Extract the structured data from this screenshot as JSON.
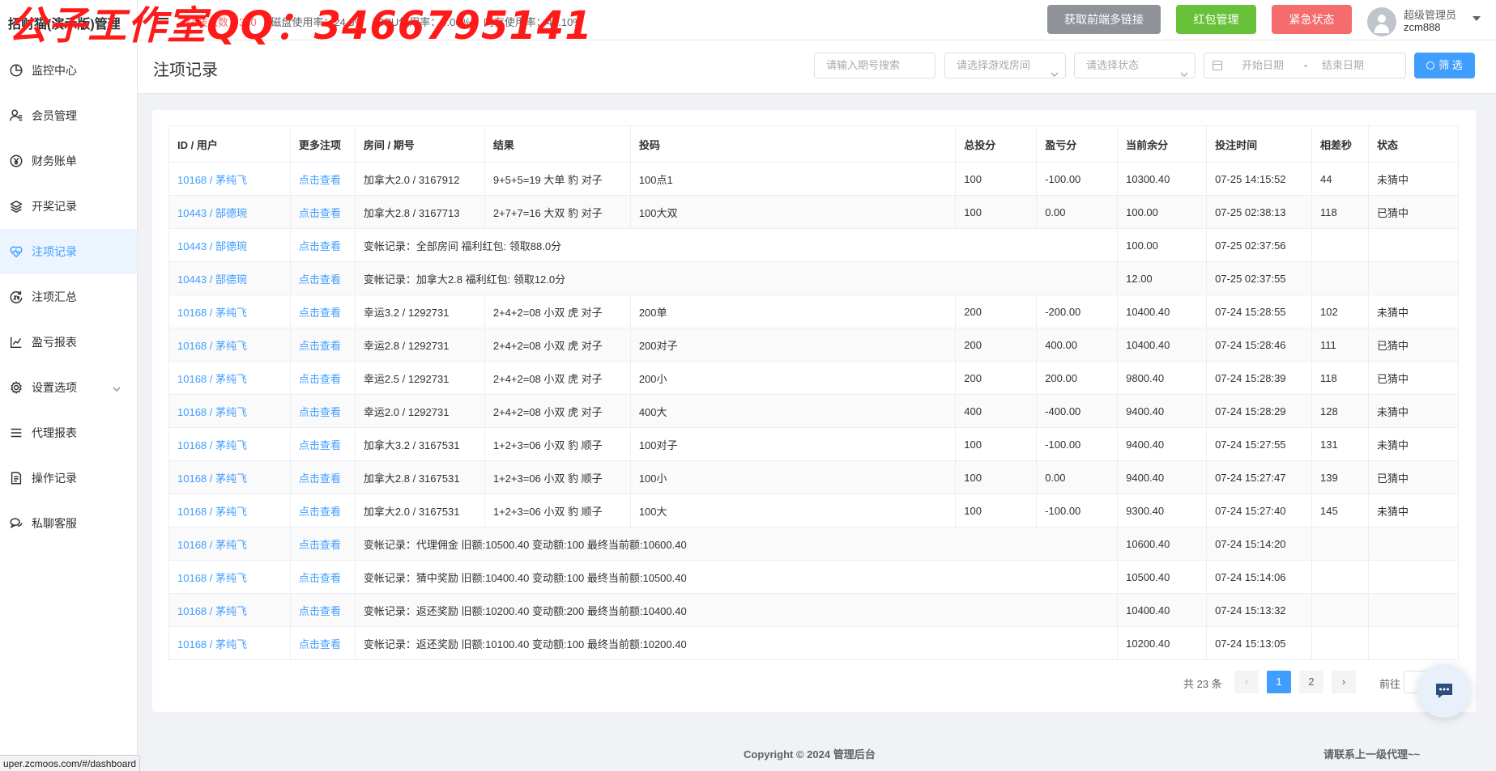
{
  "sidebar": {
    "brand": "招财猫(演示版)管理",
    "items": [
      {
        "label": "监控中心",
        "icon": "dashboard-icon"
      },
      {
        "label": "会员管理",
        "icon": "users-icon"
      },
      {
        "label": "财务账单",
        "icon": "finance-icon"
      },
      {
        "label": "开奖记录",
        "icon": "layers-icon"
      },
      {
        "label": "注项记录",
        "icon": "heart-icon"
      },
      {
        "label": "注项汇总",
        "icon": "summary-24-icon"
      },
      {
        "label": "盈亏报表",
        "icon": "trend-chart-icon"
      },
      {
        "label": "设置选项",
        "icon": "gear-icon"
      },
      {
        "label": "代理报表",
        "icon": "list-icon"
      },
      {
        "label": "操作记录",
        "icon": "document-icon"
      },
      {
        "label": "私聊客服",
        "icon": "chat-icon"
      }
    ],
    "active_index": 4
  },
  "status_url": "uper.zcmoos.com/#/dashboard",
  "header": {
    "online": "在线人数：330",
    "disk": "磁盘使用率：24.6%",
    "cpu": "CPU使用率：4.00%",
    "mem": "内存使用率：45.10%",
    "btn_links": "获取前端多链接",
    "btn_redpacket": "红包管理",
    "btn_emergency": "紧急状态",
    "user_role": "超级管理员",
    "user_name": "zcm888"
  },
  "watermark": "公子工作室QQ：3466795141",
  "page": {
    "title": "注项记录",
    "search_placeholder": "请输入期号搜索",
    "room_placeholder": "请选择游戏房间",
    "status_placeholder": "请选择状态",
    "date_start": "开始日期",
    "date_sep": "-",
    "date_end": "结束日期",
    "filter_label": "筛 选"
  },
  "table": {
    "headers": [
      "ID / 用户",
      "更多注项",
      "房间 / 期号",
      "结果",
      "投码",
      "总投分",
      "盈亏分",
      "当前余分",
      "投注时间",
      "相差秒",
      "状态"
    ],
    "rows": [
      {
        "user": "10168 / 茅纯飞",
        "more": "点击查看",
        "room": "加拿大2.0 / 3167912",
        "result": "9+5+5=19 大单 豹 对子",
        "bet": "100点1",
        "total": "100",
        "pnl": "-100.00",
        "balance": "10300.40",
        "time": "07-25 14:15:52",
        "diff": "44",
        "status": "未猜中"
      },
      {
        "user": "10443 / 郜德琬",
        "more": "点击查看",
        "room": "加拿大2.8 / 3167713",
        "result": "2+7+7=16 大双 豹 对子",
        "bet": "100大双",
        "total": "100",
        "pnl": "0.00",
        "balance": "100.00",
        "time": "07-25 02:38:13",
        "diff": "118",
        "status": "已猜中"
      },
      {
        "user": "10443 / 郜德琬",
        "more": "点击查看",
        "memo": "变帐记录：全部房间 福利红包: 领取88.0分",
        "balance": "100.00",
        "time": "07-25 02:37:56"
      },
      {
        "user": "10443 / 郜德琬",
        "more": "点击查看",
        "memo": "变帐记录：加拿大2.8 福利红包: 领取12.0分",
        "balance": "12.00",
        "time": "07-25 02:37:55"
      },
      {
        "user": "10168 / 茅纯飞",
        "more": "点击查看",
        "room": "幸运3.2 / 1292731",
        "result": "2+4+2=08 小双 虎 对子",
        "bet": "200单",
        "total": "200",
        "pnl": "-200.00",
        "balance": "10400.40",
        "time": "07-24 15:28:55",
        "diff": "102",
        "status": "未猜中"
      },
      {
        "user": "10168 / 茅纯飞",
        "more": "点击查看",
        "room": "幸运2.8 / 1292731",
        "result": "2+4+2=08 小双 虎 对子",
        "bet": "200对子",
        "total": "200",
        "pnl": "400.00",
        "balance": "10400.40",
        "time": "07-24 15:28:46",
        "diff": "111",
        "status": "已猜中"
      },
      {
        "user": "10168 / 茅纯飞",
        "more": "点击查看",
        "room": "幸运2.5 / 1292731",
        "result": "2+4+2=08 小双 虎 对子",
        "bet": "200小",
        "total": "200",
        "pnl": "200.00",
        "balance": "9800.40",
        "time": "07-24 15:28:39",
        "diff": "118",
        "status": "已猜中"
      },
      {
        "user": "10168 / 茅纯飞",
        "more": "点击查看",
        "room": "幸运2.0 / 1292731",
        "result": "2+4+2=08 小双 虎 对子",
        "bet": "400大",
        "total": "400",
        "pnl": "-400.00",
        "balance": "9400.40",
        "time": "07-24 15:28:29",
        "diff": "128",
        "status": "未猜中"
      },
      {
        "user": "10168 / 茅纯飞",
        "more": "点击查看",
        "room": "加拿大3.2 / 3167531",
        "result": "1+2+3=06 小双 豹 顺子",
        "bet": "100对子",
        "total": "100",
        "pnl": "-100.00",
        "balance": "9400.40",
        "time": "07-24 15:27:55",
        "diff": "131",
        "status": "未猜中"
      },
      {
        "user": "10168 / 茅纯飞",
        "more": "点击查看",
        "room": "加拿大2.8 / 3167531",
        "result": "1+2+3=06 小双 豹 顺子",
        "bet": "100小",
        "total": "100",
        "pnl": "0.00",
        "balance": "9400.40",
        "time": "07-24 15:27:47",
        "diff": "139",
        "status": "已猜中"
      },
      {
        "user": "10168 / 茅纯飞",
        "more": "点击查看",
        "room": "加拿大2.0 / 3167531",
        "result": "1+2+3=06 小双 豹 顺子",
        "bet": "100大",
        "total": "100",
        "pnl": "-100.00",
        "balance": "9300.40",
        "time": "07-24 15:27:40",
        "diff": "145",
        "status": "未猜中"
      },
      {
        "user": "10168 / 茅纯飞",
        "more": "点击查看",
        "memo": "变帐记录：代理佣金 旧额:10500.40 变动额:100 最终当前额:10600.40",
        "balance": "10600.40",
        "time": "07-24 15:14:20"
      },
      {
        "user": "10168 / 茅纯飞",
        "more": "点击查看",
        "memo": "变帐记录：猜中奖励 旧额:10400.40 变动额:100 最终当前额:10500.40",
        "balance": "10500.40",
        "time": "07-24 15:14:06"
      },
      {
        "user": "10168 / 茅纯飞",
        "more": "点击查看",
        "memo": "变帐记录：返还奖励 旧额:10200.40 变动额:200 最终当前额:10400.40",
        "balance": "10400.40",
        "time": "07-24 15:13:32"
      },
      {
        "user": "10168 / 茅纯飞",
        "more": "点击查看",
        "memo": "变帐记录：返还奖励 旧额:10100.40 变动额:100 最终当前额:10200.40",
        "balance": "10200.40",
        "time": "07-24 15:13:05"
      }
    ]
  },
  "pagination": {
    "total": "共 23 条",
    "pages": [
      "1",
      "2"
    ],
    "current": "1",
    "goto_label": "前往"
  },
  "footer": {
    "copyright": "Copyright © 2024 管理后台",
    "contact": "请联系上一级代理~~"
  },
  "colors": {
    "primary": "#409eff",
    "success": "#67c23a",
    "danger": "#f56c6c",
    "gray_button": "#8f9399",
    "watermark": "#ff1a1a"
  }
}
